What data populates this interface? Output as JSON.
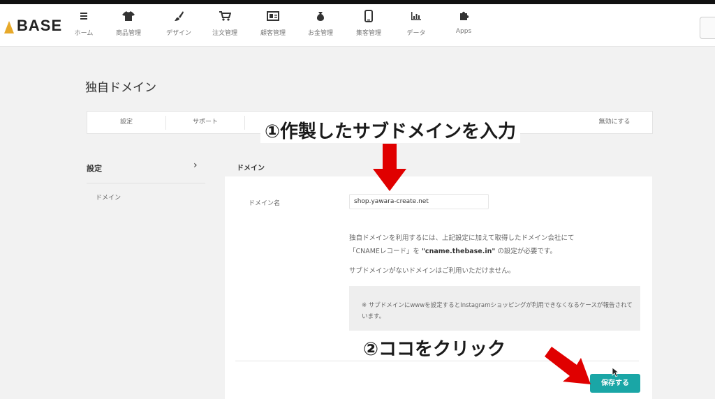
{
  "header": {
    "logo_text": "BASE",
    "nav": [
      {
        "label": "ホーム",
        "icon": "menu-icon"
      },
      {
        "label": "商品管理",
        "icon": "shirt-icon"
      },
      {
        "label": "デザイン",
        "icon": "brush-icon"
      },
      {
        "label": "注文管理",
        "icon": "cart-icon"
      },
      {
        "label": "顧客管理",
        "icon": "customer-card-icon"
      },
      {
        "label": "お金管理",
        "icon": "money-bag-icon"
      },
      {
        "label": "集客管理",
        "icon": "phone-icon"
      },
      {
        "label": "データ",
        "icon": "bar-chart-icon"
      },
      {
        "label": "Apps",
        "icon": "puzzle-icon"
      }
    ]
  },
  "page": {
    "title": "独自ドメイン",
    "tabs": [
      "設定",
      "サポート",
      "無効にする"
    ]
  },
  "sidebar": {
    "settings_label": "設定",
    "chevron": "›",
    "items": [
      "ドメイン"
    ]
  },
  "main": {
    "section_title": "ドメイン",
    "field_label": "ドメイン名",
    "domain_value": "shop.yawara-create.net",
    "help_line1": "独自ドメインを利用するには、上記設定に加えて取得したドメイン会社にて",
    "help_line2_pre": "「CNAMEレコード」を",
    "help_line2_bold": "\"cname.thebase.in\"",
    "help_line2_post": "の設定が必要です。",
    "help_line3": "サブドメインがないドメインはご利用いただけません。",
    "note": "※ サブドメインにwwwを設定するとInstagramショッピングが利用できなくなるケースが報告されています。",
    "save_label": "保存する"
  },
  "annotations": {
    "step1": "①作製したサブドメインを入力",
    "step2": "②ココをクリック",
    "arrow_color": "#e00000"
  },
  "colors": {
    "accent": "#1aa6a6",
    "annotation_red": "#e00000"
  }
}
